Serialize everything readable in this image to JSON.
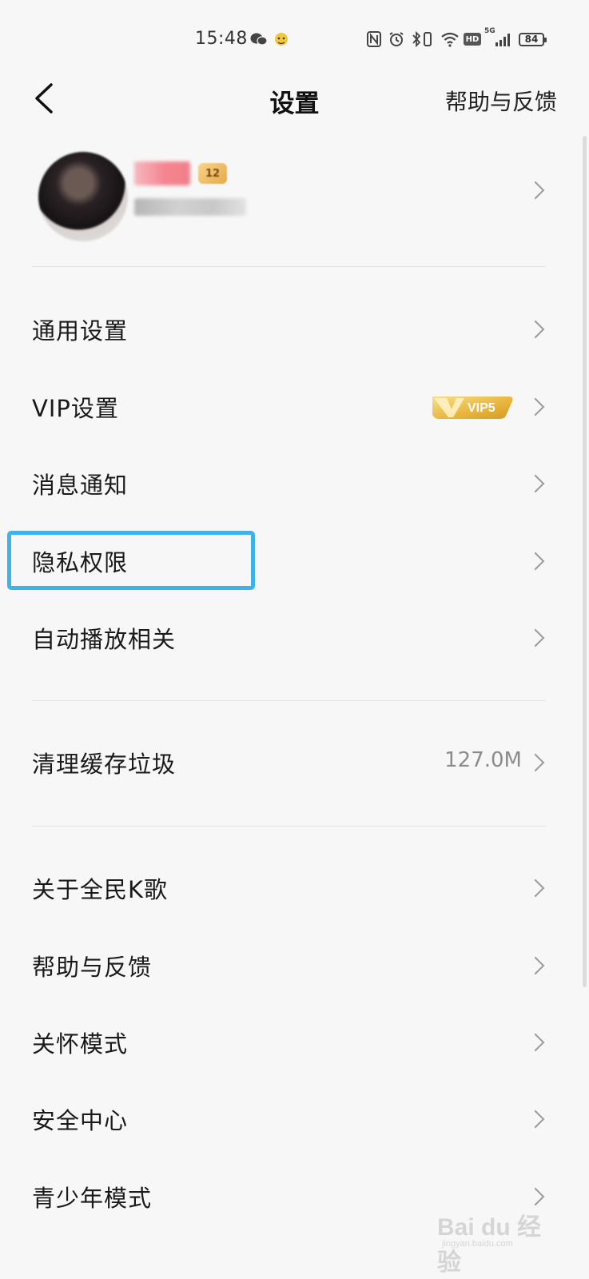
{
  "status_bar": {
    "time": "15:48",
    "icons": [
      "wechat-icon",
      "mascot-icon",
      "nfc-icon",
      "alarm-icon",
      "bluetooth-icon",
      "vibrate-icon",
      "wifi-icon",
      "hd-icon",
      "signal-5g-icon",
      "battery-icon"
    ],
    "hd_label": "HD",
    "network_label": "5G",
    "battery_level": "84"
  },
  "nav": {
    "title": "设置",
    "right_action": "帮助与反馈"
  },
  "profile": {
    "level_badge": "12"
  },
  "menu_group_1": [
    {
      "label": "通用设置"
    },
    {
      "label": "VIP设置",
      "badge": "VIP5"
    },
    {
      "label": "消息通知"
    },
    {
      "label": "隐私权限",
      "highlighted": true
    },
    {
      "label": "自动播放相关"
    }
  ],
  "menu_group_2": [
    {
      "label": "清理缓存垃圾",
      "value": "127.0M"
    }
  ],
  "menu_group_3": [
    {
      "label": "关于全民K歌"
    },
    {
      "label": "帮助与反馈"
    },
    {
      "label": "关怀模式"
    },
    {
      "label": "安全中心"
    },
    {
      "label": "青少年模式"
    }
  ],
  "colors": {
    "highlight": "#3db3e8",
    "vip_gold": "#e9b73f",
    "background": "#f7f7f7"
  },
  "watermark": {
    "main": "Bai du 经验",
    "sub": "jingyan.baidu.com"
  }
}
